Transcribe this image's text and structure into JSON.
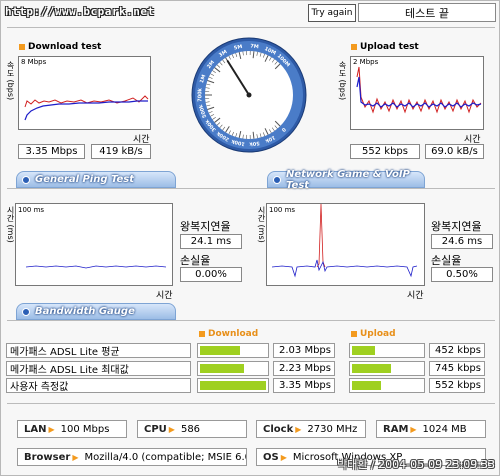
{
  "header": {
    "url": "http://www.bcpark.net",
    "try_again": "Try again",
    "status": "테스트 끝"
  },
  "download": {
    "title": "Download test",
    "ylabel": "속도 (bps)",
    "scale": "8 Mbps",
    "xlabel": "시간",
    "mbps": "3.35 Mbps",
    "kbs": "419 kB/s"
  },
  "upload": {
    "title": "Upload test",
    "ylabel": "속도 (bps)",
    "scale": "2 Mbps",
    "xlabel": "시간",
    "kbps": "552 kbps",
    "kbs": "69.0 kB/s"
  },
  "gauge": {
    "ticks": [
      "0",
      "10k",
      "50k",
      "100k",
      "200k",
      "300k",
      "500k",
      "700k",
      "1M",
      "2M",
      "3M",
      "5M",
      "7M",
      "10M",
      "100M"
    ],
    "needle_value": "3M"
  },
  "tabs": {
    "ping": "General Ping Test",
    "game": "Network Game & VoIP Test",
    "bandwidth": "Bandwidth Gauge"
  },
  "ping_left": {
    "ylabel": "시간 (ms)",
    "scale": "100 ms",
    "xlabel": "시간",
    "rtt_label": "왕복지연율",
    "rtt": "24.1 ms",
    "loss_label": "손실율",
    "loss": "0.00%"
  },
  "ping_right": {
    "ylabel": "시간 (ms)",
    "scale": "100 ms",
    "xlabel": "시간",
    "rtt_label": "왕복지연율",
    "rtt": "24.6 ms",
    "loss_label": "손실율",
    "loss": "0.50%"
  },
  "bandwidth": {
    "download_header": "Download",
    "upload_header": "Upload",
    "rows": [
      {
        "label": "메가패스 ADSL Lite 평균",
        "down": "2.03 Mbps",
        "up": "452 kbps",
        "down_frac": 0.61,
        "up_frac": 0.33
      },
      {
        "label": "메가패스 ADSL Lite 최대값",
        "down": "2.23 Mbps",
        "up": "745 kbps",
        "down_frac": 0.67,
        "up_frac": 0.55
      },
      {
        "label": "사용자 측정값",
        "down": "3.35 Mbps",
        "up": "552 kbps",
        "down_frac": 1.0,
        "up_frac": 0.41
      }
    ]
  },
  "sysinfo": {
    "lan_label": "LAN",
    "lan": "100 Mbps",
    "cpu_label": "CPU",
    "cpu": "586",
    "clock_label": "Clock",
    "clock": "2730 MHz",
    "ram_label": "RAM",
    "ram": "1024 MB",
    "browser_label": "Browser",
    "browser": "Mozilla/4.0 (compatible; MSIE 6.0",
    "os_label": "OS",
    "os": "Microsoft Windows XP"
  },
  "footer": "박태환 / 2004-05-09 23:09:33",
  "colors": {
    "accent": "#f39a1e",
    "bar": "#9fd020",
    "tab": "#9cbde6",
    "download_line": "#1d1dc9",
    "upload_line": "#d11f1f"
  }
}
